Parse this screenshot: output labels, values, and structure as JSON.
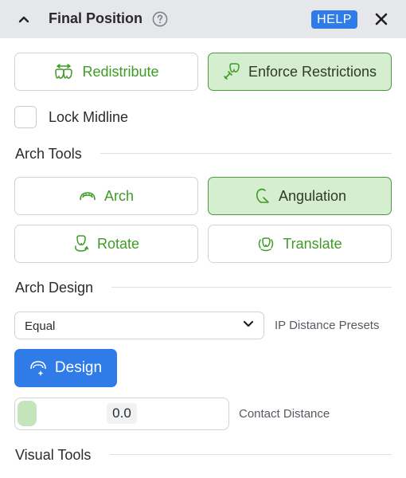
{
  "header": {
    "title": "Final Position",
    "help_badge": "HELP"
  },
  "position_tools": {
    "redistribute": "Redistribute",
    "enforce": "Enforce Restrictions",
    "lock_midline": "Lock Midline"
  },
  "arch_tools": {
    "title": "Arch Tools",
    "arch": "Arch",
    "angulation": "Angulation",
    "rotate": "Rotate",
    "translate": "Translate"
  },
  "arch_design": {
    "title": "Arch Design",
    "preset_value": "Equal",
    "preset_label": "IP Distance Presets",
    "design_button": "Design",
    "contact_value": "0.0",
    "contact_label": "Contact Distance"
  },
  "visual_tools": {
    "title": "Visual Tools"
  },
  "colors": {
    "accent_blue": "#2f7be8",
    "green_text": "#3e9b26",
    "active_bg": "#d5eecf",
    "header_bg": "#e6e7ea"
  }
}
